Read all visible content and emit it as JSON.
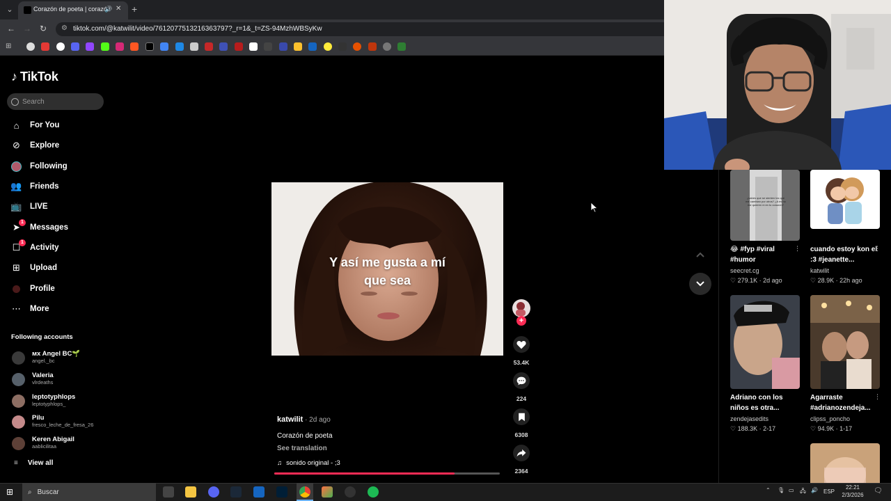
{
  "browser": {
    "tab_title": "Corazón de poeta | corazón",
    "url": "tiktok.com/@katwilit/video/7612077513216363797?_r=1&_t=ZS-94MzhWBSyKw"
  },
  "sidebar": {
    "brand": "TikTok",
    "search_placeholder": "Search",
    "nav": [
      {
        "label": "For You"
      },
      {
        "label": "Explore"
      },
      {
        "label": "Following"
      },
      {
        "label": "Friends"
      },
      {
        "label": "LIVE"
      },
      {
        "label": "Messages",
        "badge": "1"
      },
      {
        "label": "Activity",
        "badge": "1"
      },
      {
        "label": "Upload"
      },
      {
        "label": "Profile"
      },
      {
        "label": "More"
      }
    ],
    "following_title": "Following accounts",
    "accounts": [
      {
        "name": "ᴍx Angel BC🌱",
        "handle": "angel._bc"
      },
      {
        "name": "Valeria",
        "handle": "vlrdeaths"
      },
      {
        "name": "leptotyphlops",
        "handle": "leptotyphlops_"
      },
      {
        "name": "Pilu",
        "handle": "fresco_leche_de_fresa_26"
      },
      {
        "name": "Keren Abigail",
        "handle": "aablicilitaa"
      }
    ],
    "view_all": "View all"
  },
  "video": {
    "caption_line1": "Y así me gusta a mí",
    "caption_line2": "que sea",
    "author": "katwilit",
    "ago": " · 2d ago",
    "description": "Corazón de poeta",
    "see_translation": "See translation",
    "sound": "sonido original - ;3",
    "progress_fraction": 0.8,
    "likes": "53.4K",
    "comments": "224",
    "saves": "6308",
    "shares": "2364"
  },
  "recommendations": [
    {
      "title": "😂 #fyp #viral #humor",
      "user": "seecret.cg",
      "likes": "279.1K",
      "date": "2d ago",
      "thumb_text": "¿sabes que se sienten los que me cambian por otros? ¿A mi no me quieren ni en tu corazón?"
    },
    {
      "title": "cuando estoy kon el :3 #jeanette...",
      "user": "katwilit",
      "likes": "28.9K",
      "date": "22h ago"
    },
    {
      "title": "Adriano con los niños es otra...",
      "user": "zendejasedits",
      "likes": "188.3K",
      "date": "2-17"
    },
    {
      "title": "Agarraste #adrianozendeja...",
      "user": "clipss_poncho",
      "likes": "94.9K",
      "date": "1-17"
    }
  ],
  "taskbar": {
    "search": "Buscar",
    "lang": "ESP",
    "time": "22:21",
    "date": "2/3/2026"
  }
}
